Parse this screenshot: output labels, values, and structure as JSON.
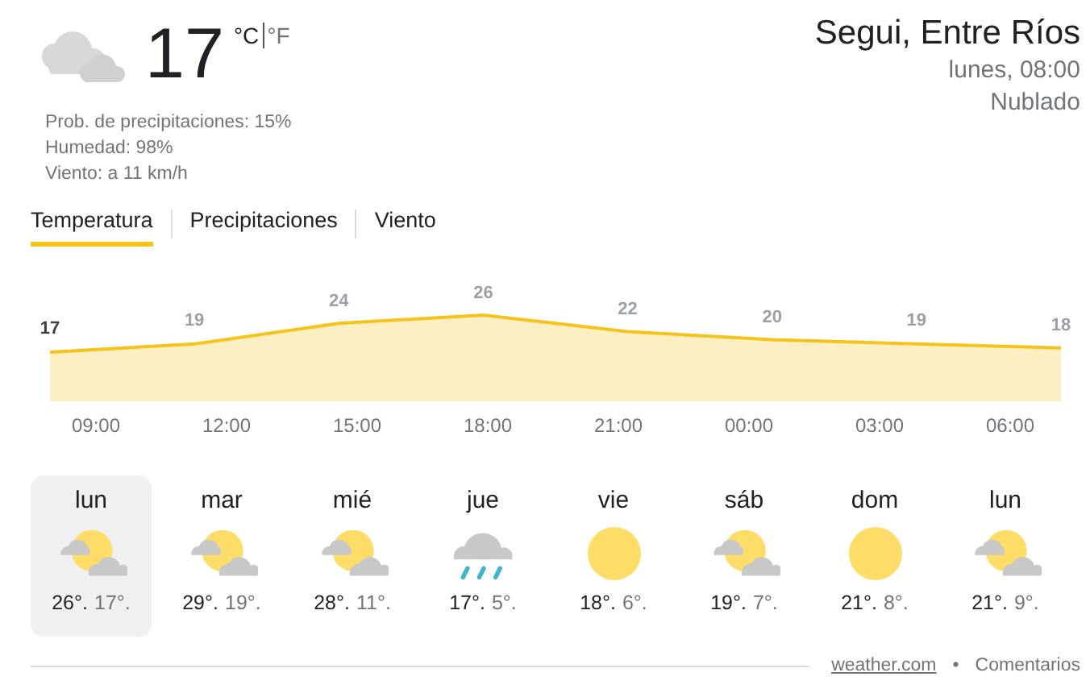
{
  "current": {
    "kind": "cloudy",
    "temperature": "17",
    "units": [
      {
        "label": "°C",
        "selected": true
      },
      {
        "label": "°F",
        "selected": false
      }
    ],
    "details": [
      "Prob. de precipitaciones: 15%",
      "Humedad: 98%",
      "Viento: a 11 km/h"
    ]
  },
  "location": {
    "place": "Segui, Entre Ríos",
    "time": "lunes, 08:00",
    "condition": "Nublado"
  },
  "tabs": [
    {
      "label": "Temperatura",
      "selected": true
    },
    {
      "label": "Precipitaciones",
      "selected": false
    },
    {
      "label": "Viento",
      "selected": false
    }
  ],
  "chart": {
    "chart_data": {
      "type": "area",
      "categories": [
        null,
        null,
        null,
        null,
        null,
        null,
        null,
        null
      ],
      "series": [
        {
          "color": "#f6c31b",
          "values": [
            17,
            19,
            24,
            26,
            22,
            20,
            19,
            18
          ]
        }
      ],
      "data_labels": true
    },
    "times": [
      "09:00",
      "12:00",
      "15:00",
      "18:00",
      "21:00",
      "00:00",
      "03:00",
      "06:00"
    ]
  },
  "days": [
    {
      "day": "lun",
      "kind": "partly_cloudy",
      "high": "26°.",
      "low": "17°.",
      "selected": true
    },
    {
      "day": "mar",
      "kind": "partly_cloudy",
      "high": "29°.",
      "low": "19°.",
      "selected": false
    },
    {
      "day": "mié",
      "kind": "partly_cloudy",
      "high": "28°.",
      "low": "11°.",
      "selected": false
    },
    {
      "day": "jue",
      "kind": "rain",
      "high": "17°.",
      "low": "5°.",
      "selected": false
    },
    {
      "day": "vie",
      "kind": "sunny",
      "high": "18°.",
      "low": "6°.",
      "selected": false
    },
    {
      "day": "sáb",
      "kind": "partly_cloudy",
      "high": "19°.",
      "low": "7°.",
      "selected": false
    },
    {
      "day": "dom",
      "kind": "sunny",
      "high": "21°.",
      "low": "8°.",
      "selected": false
    },
    {
      "day": "lun",
      "kind": "partly_cloudy",
      "high": "21°.",
      "low": "9°.",
      "selected": false
    }
  ],
  "footer": {
    "source": "weather.com",
    "separator": "•",
    "feedback": "Comentarios"
  }
}
